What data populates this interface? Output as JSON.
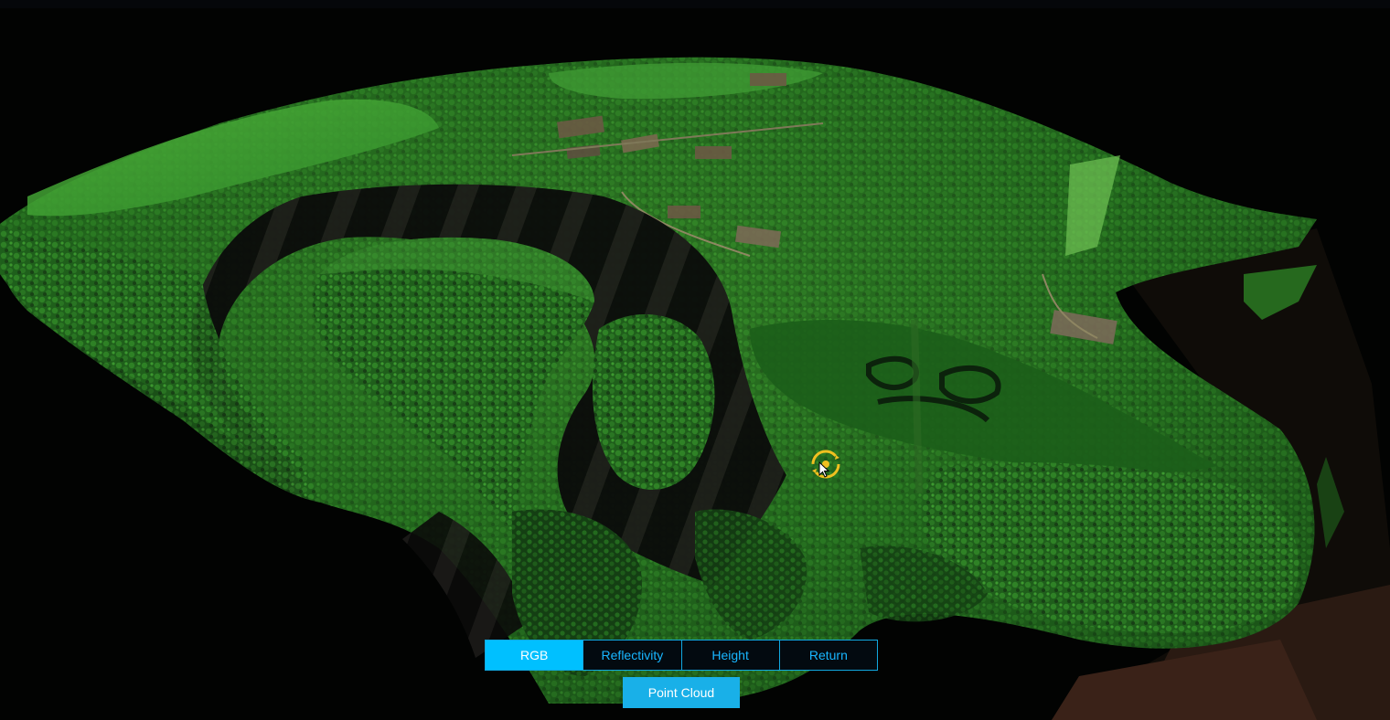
{
  "viewer": {
    "mode_tabs": [
      {
        "label": "RGB",
        "active": true
      },
      {
        "label": "Reflectivity",
        "active": false
      },
      {
        "label": "Height",
        "active": false
      },
      {
        "label": "Return",
        "active": false
      }
    ],
    "view_button_label": "Point Cloud",
    "colors": {
      "accent": "#00c0ff",
      "accent_text": "#18b6ff",
      "cursor_ring": "#f0c020",
      "background": "#000000"
    },
    "icons": [
      "orbit-cursor-icon"
    ]
  }
}
